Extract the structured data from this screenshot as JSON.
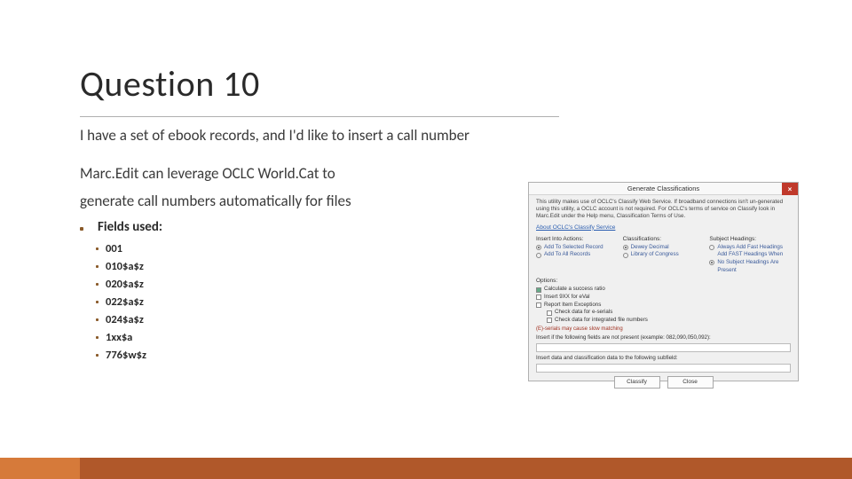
{
  "title": "Question 10",
  "subtitle": "I have a set of ebook records, and I'd like to insert a call number",
  "body_line1": "Marc.Edit can leverage OCLC World.Cat to",
  "body_line2": "generate call numbers automatically for files",
  "fields_label": "Fields used:",
  "fields": [
    "001",
    "010$a$z",
    "020$a$z",
    "022$a$z",
    "024$a$z",
    "1xx$a",
    "776$w$z"
  ],
  "dialog": {
    "title": "Generate Classifications",
    "close": "×",
    "desc": "This utility makes use of OCLC's Classify Web Service. If broadband connections isn't un-generated using this utility, a OCLC account is not required. For OCLC's terms of service on Classify look in Marc.Edit under the Help menu, Classification Terms of Use.",
    "link": "About OCLC's Classify Service",
    "col1_label": "Insert Into Actions:",
    "col1_opt1": "Add To Selected Record",
    "col1_opt2": "Add To All Records",
    "col2_label": "Classifications:",
    "col2_opt1": "Dewey Decimal",
    "col2_opt2": "Library of Congress",
    "col3_label": "Subject Headings:",
    "col3_opt1": "Always Add Fast Headings",
    "col3_opt2": "Add FAST Headings When No Subject Headings Are Present",
    "opts_label": "Options:",
    "opt1": "Calculate a success ratio",
    "opt2": "Insert 9XX for eVal",
    "opt3": "Report Item Exceptions",
    "opt3a": "Check data for e-serials",
    "opt3b": "Check data for integrated file numbers",
    "warn": "(E)-serials may cause slow matching",
    "note1": "Insert if the following fields are not present (example: 082,090,050,092):",
    "note2": "Insert data and classification data to the following subfield:",
    "btn1": "Classify",
    "btn2": "Close"
  }
}
